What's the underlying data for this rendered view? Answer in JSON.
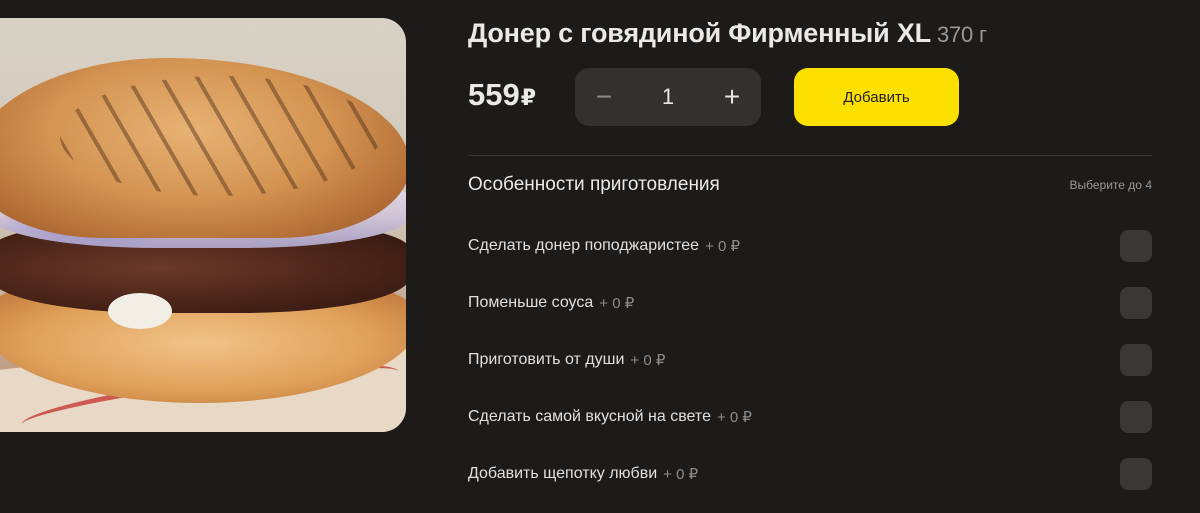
{
  "product": {
    "title": "Донер с говядиной Фирменный XL",
    "weight": "370 г",
    "price": "559",
    "currency": "₽",
    "quantity": "1",
    "minus_symbol": "−",
    "plus_symbol": "+",
    "add_label": "Добавить"
  },
  "options_section": {
    "title": "Особенности приготовления",
    "hint": "Выберите до 4",
    "items": [
      {
        "label": "Сделать донер поподжаристее",
        "price": "+ 0 ₽"
      },
      {
        "label": "Поменьше соуса",
        "price": "+ 0 ₽"
      },
      {
        "label": "Приготовить от души",
        "price": "+ 0 ₽"
      },
      {
        "label": "Сделать самой вкусной на свете",
        "price": "+ 0 ₽"
      },
      {
        "label": "Добавить щепотку любви",
        "price": "+ 0 ₽"
      }
    ]
  },
  "colors": {
    "background": "#1c1b1a",
    "accent_button": "#fce000",
    "stepper_bg": "#33312f",
    "checkbox_bg": "#3a3836"
  }
}
